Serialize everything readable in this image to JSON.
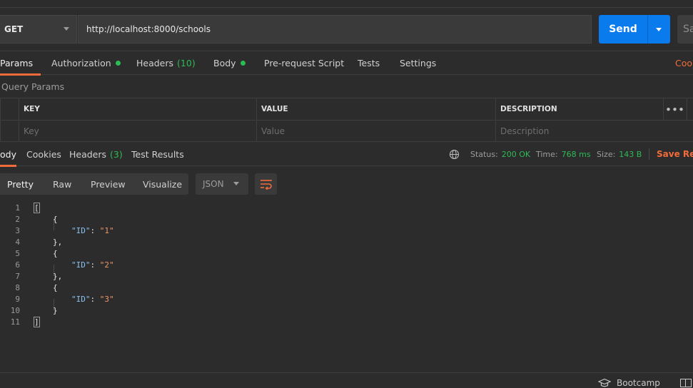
{
  "request": {
    "method": "GET",
    "url": "http://localhost:8000/schools",
    "send_label": "Send",
    "save_label": "Sa"
  },
  "request_tabs": {
    "params": "Params",
    "authorization": "Authorization",
    "headers": "Headers",
    "headers_count": "(10)",
    "body": "Body",
    "prerequest": "Pre-request Script",
    "tests": "Tests",
    "settings": "Settings",
    "cookies": "Cook"
  },
  "query_params": {
    "title": "Query Params",
    "columns": [
      "KEY",
      "VALUE",
      "DESCRIPTION"
    ],
    "placeholders": [
      "Key",
      "Value",
      "Description"
    ],
    "more": "•••"
  },
  "response_tabs": {
    "body": "ody",
    "cookies": "Cookies",
    "headers": "Headers",
    "headers_count": "(3)",
    "test_results": "Test Results"
  },
  "response_status": {
    "status_label": "Status:",
    "status_value": "200 OK",
    "time_label": "Time:",
    "time_value": "768 ms",
    "size_label": "Size:",
    "size_value": "143 B",
    "save_response": "Save Res"
  },
  "viewer": {
    "tabs": [
      "Pretty",
      "Raw",
      "Preview",
      "Visualize"
    ],
    "active": "Pretty",
    "format": "JSON"
  },
  "code": {
    "line_numbers": [
      "1",
      "2",
      "3",
      "4",
      "5",
      "6",
      "7",
      "8",
      "9",
      "10",
      "11"
    ],
    "open_bracket": "[",
    "close_bracket": "]",
    "open_brace": "{",
    "close_brace": "}",
    "close_brace_comma": "},",
    "key": "\"ID\"",
    "colon": ": ",
    "values": [
      "\"1\"",
      "\"2\"",
      "\"3\""
    ]
  },
  "footer": {
    "bootcamp": "Bootcamp"
  },
  "colors": {
    "accent": "#f26b3a",
    "send": "#097bed",
    "success": "#2dbb55"
  }
}
